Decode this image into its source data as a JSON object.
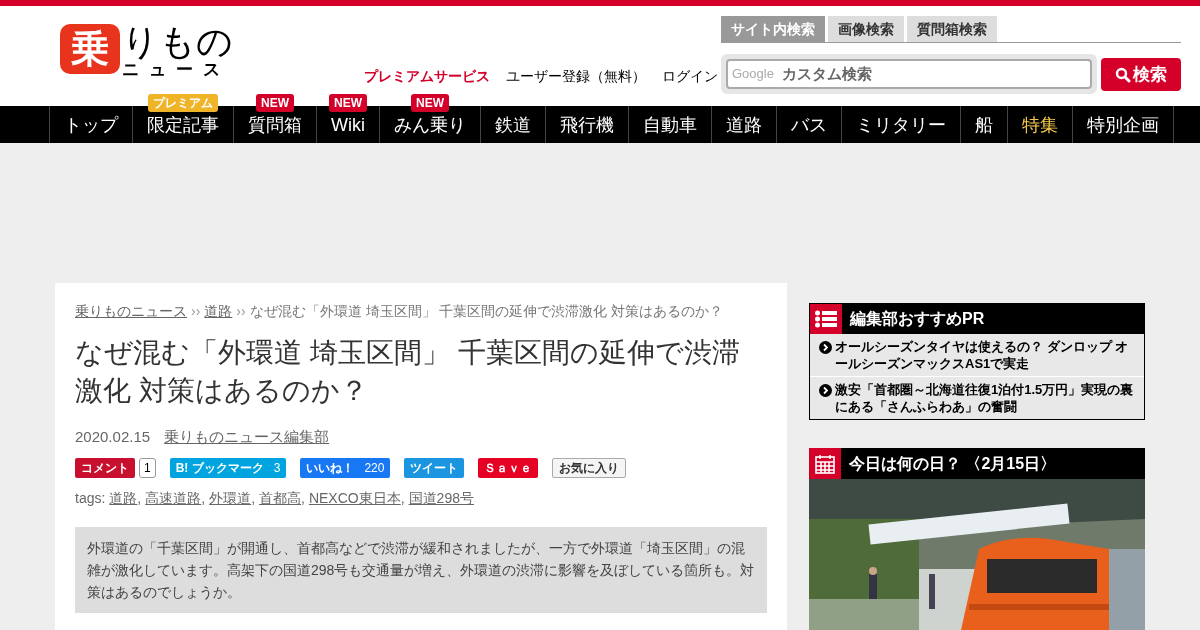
{
  "header": {
    "logo_mark": "乗",
    "logo_text": "りもの",
    "logo_sub": "ニュース",
    "links": [
      {
        "label": "プレミアムサービス",
        "kind": "premium"
      },
      {
        "label": "ユーザー登録（無料）",
        "kind": "plain"
      },
      {
        "label": "ログイン",
        "kind": "plain"
      }
    ],
    "search_tabs": [
      {
        "label": "サイト内検索",
        "selected": true
      },
      {
        "label": "画像検索",
        "selected": false
      },
      {
        "label": "質問箱検索",
        "selected": false
      }
    ],
    "search": {
      "brand": "Google",
      "placeholder": "カスタム検索",
      "button": "検索"
    }
  },
  "nav": [
    {
      "label": "トップ",
      "featured": false
    },
    {
      "label": "限定記事",
      "featured": false,
      "badge": {
        "text": "プレミアム",
        "color": "#f0b429"
      }
    },
    {
      "label": "質問箱",
      "featured": false,
      "badge": {
        "text": "NEW",
        "color": "#d4002a"
      }
    },
    {
      "label": "Wiki",
      "featured": false,
      "badge": {
        "text": "NEW",
        "color": "#d4002a"
      }
    },
    {
      "label": "みん乗り",
      "featured": false,
      "badge": {
        "text": "NEW",
        "color": "#d4002a"
      }
    },
    {
      "label": "鉄道",
      "featured": false
    },
    {
      "label": "飛行機",
      "featured": false
    },
    {
      "label": "自動車",
      "featured": false
    },
    {
      "label": "道路",
      "featured": false
    },
    {
      "label": "バス",
      "featured": false
    },
    {
      "label": "ミリタリー",
      "featured": false
    },
    {
      "label": "船",
      "featured": false
    },
    {
      "label": "特集",
      "featured": true
    },
    {
      "label": "特別企画",
      "featured": false
    }
  ],
  "article": {
    "breadcrumb_separator": "››",
    "tag_separator": ",",
    "breadcrumb": [
      {
        "label": "乗りものニュース",
        "link": true
      },
      {
        "label": "道路",
        "link": true
      },
      {
        "label": "なぜ混む「外環道 埼玉区間」 千葉区間の延伸で渋滞激化 対策はあるのか？",
        "link": false
      }
    ],
    "title": "なぜ混む「外環道 埼玉区間」 千葉区間の延伸で渋滞激化 対策はあるのか？",
    "date": "2020.02.15",
    "author": "乗りものニュース編集部",
    "share": [
      {
        "kind": "comment",
        "label": "コメント",
        "count": "1"
      },
      {
        "kind": "hatena",
        "label": "B! ブックマーク",
        "count": "3"
      },
      {
        "kind": "like",
        "label": "いいね！",
        "count": "220"
      },
      {
        "kind": "tweet",
        "label": "ツイート"
      },
      {
        "kind": "pin",
        "label": "Ｓａｖｅ"
      },
      {
        "kind": "fav",
        "label": "お気に入り"
      }
    ],
    "tags_label": "tags:",
    "tags": [
      "道路",
      "高速道路",
      "外環道",
      "首都高",
      "NEXCO東日本",
      "国道298号"
    ],
    "lead": "外環道の「千葉区間」が開通し、首都高などで渋滞が緩和されましたが、一方で外環道「埼玉区間」の混雑が激化しています。高架下の国道298号も交通量が増え、外環道の渋滞に影響を及ぼしている箇所も。対策はあるのでしょうか。"
  },
  "sidebar": {
    "pr": {
      "title": "編集部おすすめPR",
      "items": [
        "オールシーズンタイヤは使えるの？ ダンロップ オールシーズンマックスAS1で実走",
        "激安「首都圏～北海道往復1泊付1.5万円」実現の裏にある「さんふらわあ」の奮闘"
      ]
    },
    "today": {
      "title": "今日は何の日？ 〈2月15日〉",
      "kind": "picture"
    }
  }
}
